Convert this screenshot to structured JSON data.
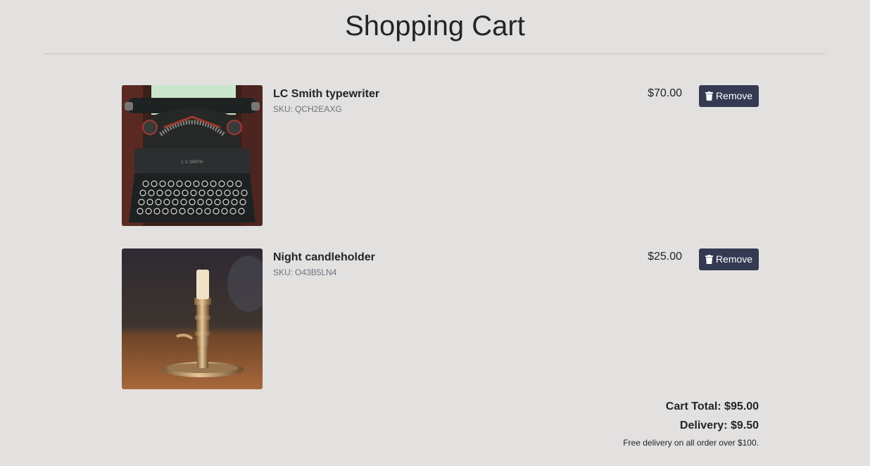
{
  "page": {
    "title": "Shopping Cart"
  },
  "cart": {
    "sku_label": "SKU:",
    "items": [
      {
        "name": "LC Smith typewriter",
        "sku": "QCH2EAXG",
        "price": "$70.00",
        "image": "typewriter-photo",
        "remove_label": "Remove"
      },
      {
        "name": "Night candleholder",
        "sku": "O43B5LN4",
        "price": "$25.00",
        "image": "candleholder-photo",
        "remove_label": "Remove"
      }
    ]
  },
  "summary": {
    "cart_total": "Cart Total: $95.00",
    "delivery": "Delivery: $9.50",
    "delivery_note": "Free delivery on all order over $100."
  },
  "colors": {
    "background": "#e3e0e0",
    "button": "#343a52",
    "sku_text": "#6c757d",
    "text": "#212529"
  },
  "icons": {
    "remove": "trash-icon"
  }
}
